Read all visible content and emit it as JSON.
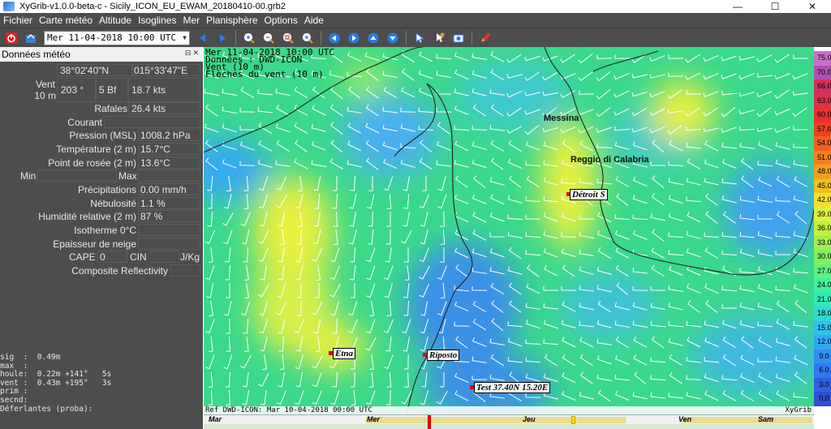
{
  "window": {
    "title": "XyGrib-v1.0.0-beta-c - Sicily_ICON_EU_EWAM_20180410-00.grb2",
    "controls": [
      "—",
      "☐",
      "✕"
    ]
  },
  "menu": [
    "Fichier",
    "Carte météo",
    "Altitude",
    "Isoglines",
    "Mer",
    "Planisphère",
    "Options",
    "Aide"
  ],
  "toolbar": {
    "date_value": "Mer 11-04-2018 10:00 UTC",
    "buttons": [
      "power-icon",
      "open-icon",
      "prev-icon",
      "next-icon",
      "zoom-in-icon",
      "zoom-out-icon",
      "zoom-area-icon",
      "zoom-fit-icon",
      "go-left-icon",
      "go-right-icon",
      "go-up-icon",
      "go-down-icon",
      "select-icon",
      "anim-icon",
      "screenshot-icon",
      "rocket-icon"
    ]
  },
  "panel": {
    "title": "Données météo",
    "lat": "38°02'40\"N",
    "lon": "015°33'47\"E",
    "wind_label": "Vent",
    "wind_label2": "10 m",
    "wind_dir": "203 °",
    "wind_bf": "5 Bf",
    "wind_speed": "18.7 kts",
    "gust_label": "Rafales",
    "gust_value": "26.4 kts",
    "current_label": "Courant",
    "pressure_label": "Pression (MSL)",
    "pressure_value": "1008.2 hPa",
    "temp_label": "Température (2 m)",
    "temp_value": "15.7°C",
    "dew_label": "Point de rosée (2 m)",
    "dew_value": "13.6°C",
    "min_label": "Min",
    "max_label": "Max",
    "precip_label": "Précipitations",
    "precip_value": "0.00 mm/h",
    "cloud_label": "Nébulosité",
    "cloud_value": "1.1 %",
    "humid_label": "Humidité relative (2 m)",
    "humid_value": "87 %",
    "iso_label": "Isotherme 0°C",
    "snow_label": "Epaisseur de neige",
    "cape_label": "CAPE",
    "cape_value": "0",
    "cin_label": "CIN",
    "cin_unit": "J/Kg",
    "refl_label": "Composite Reflectivity",
    "wave_lines": [
      "sig  :  0.49m",
      "max  :",
      "houle:  0.22m +141°   5s",
      "vent :  0.43m +195°   3s",
      "prim :",
      "secnd:",
      "Déferlantes (proba):"
    ]
  },
  "map": {
    "header_lines": [
      "Mer 11-04-2018 10:00 UTC",
      "Données : DWD-ICON",
      "Vent (10 m)",
      "Flèches du vent (10 m)"
    ],
    "cities": [
      "Messina",
      "Reggio di Calabria"
    ],
    "pois": [
      "Détroit S",
      "Etna",
      "Riposto",
      "Test 37.40N 15.20E"
    ],
    "footer_left": "Ref DWD-ICON: Mar 10-04-2018 00:00 UTC",
    "footer_right": "XyGrib",
    "colors": {
      "land": "#2a2a2a",
      "barb": "#ffffff"
    }
  },
  "scale": {
    "labels": [
      "75.0",
      "70.0",
      "66.0",
      "63.0",
      "60.0",
      "57.0",
      "54.0",
      "51.0",
      "48.0",
      "45.0",
      "42.0",
      "39.0",
      "36.0",
      "33.0",
      "30.0",
      "27.0",
      "24.0",
      "21.0",
      "18.0",
      "15.0",
      "12.0",
      "9.0",
      "6.0",
      "3.0",
      "0.0"
    ],
    "colors": [
      "#c870c8",
      "#b050b0",
      "#d03060",
      "#e03050",
      "#e83030",
      "#f04020",
      "#f06020",
      "#f08020",
      "#f0a020",
      "#f0c020",
      "#f0e030",
      "#e0f040",
      "#c0f040",
      "#a0f050",
      "#80f060",
      "#60f080",
      "#40f0a0",
      "#30e8b8",
      "#30d8d0",
      "#30c0e8",
      "#30a8f0",
      "#3090f0",
      "#3078f0",
      "#3060e0",
      "#3050d0"
    ]
  },
  "timeline": {
    "days": [
      "Mar",
      "Mer",
      "Jeu",
      "Ven",
      "Sam"
    ]
  }
}
